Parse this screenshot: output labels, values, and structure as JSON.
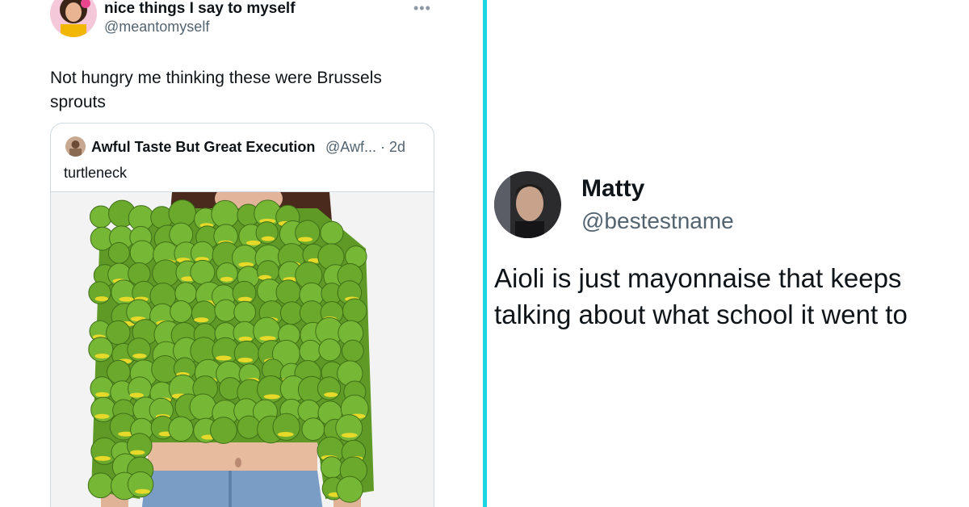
{
  "left_tweet": {
    "author_name": "nice things I say to myself",
    "author_handle": "@meantomyself",
    "more_icon": "more-horizontal-icon",
    "text": "Not hungry me thinking these were Brussels sprouts",
    "quote": {
      "author_name": "Awful Taste But Great Execution",
      "meta": "@Awf... · 2d",
      "text": "turtleneck"
    }
  },
  "right_tweet": {
    "author_name": "Matty",
    "author_handle": "@bestestname",
    "text": "Aioli is just mayonnaise that keeps talking about what school it went to"
  },
  "colors": {
    "divider": "#1ad6e0",
    "secondary_text": "#536471",
    "border": "#cfd9de",
    "turtle_green": "#6aa92c",
    "turtle_yellow": "#e6d92a"
  }
}
